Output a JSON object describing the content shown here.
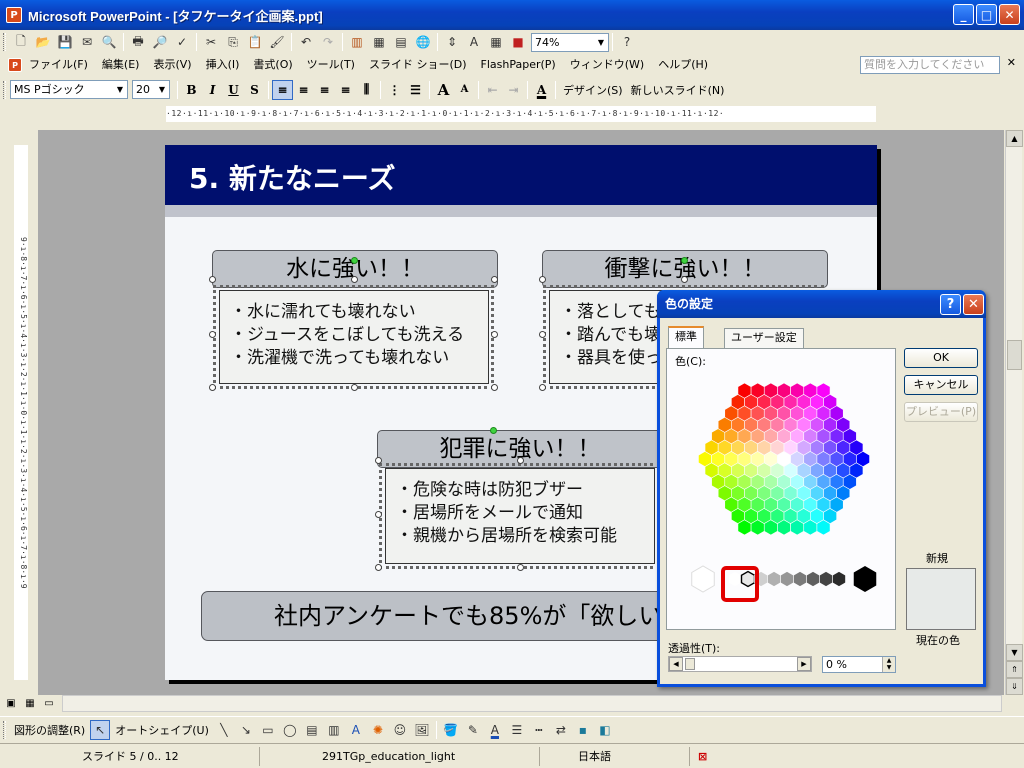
{
  "window": {
    "title": "Microsoft PowerPoint - [タフケータイ企画案.ppt]",
    "app_icon": "P",
    "min": "_",
    "max": "□",
    "close": "✕"
  },
  "toolbar": {
    "zoom": "74%",
    "help_placeholder": "質問を入力してください"
  },
  "menu": {
    "items": [
      "ファイル(F)",
      "編集(E)",
      "表示(V)",
      "挿入(I)",
      "書式(O)",
      "ツール(T)",
      "スライド ショー(D)",
      "FlashPaper(P)",
      "ウィンドウ(W)",
      "ヘルプ(H)"
    ],
    "close": "✕"
  },
  "format": {
    "font": "MS Pゴシック",
    "size": "20",
    "design": "デザイン(S)",
    "new_slide": "新しいスライド(N)"
  },
  "ruler": {
    "horizontal": "·12·ı·11·ı·10·ı·9·ı·8·ı·7·ı·6·ı·5·ı·4·ı·3·ı·2·ı·1·ı·0·ı·1·ı·2·ı·3·ı·4·ı·5·ı·6·ı·7·ı·8·ı·9·ı·10·ı·11·ı·12·",
    "vertical": "9·ı·8·ı·7·ı·6·ı·5·ı·4·ı·3·ı·2·ı·1·ı·0·ı·1·ı·2·ı·3·ı·4·ı·5·ı·6·ı·7·ı·8·ı·9"
  },
  "slide": {
    "title": "5. 新たなニーズ",
    "box1": {
      "title": "水に強い！！",
      "lines": [
        "・水に濡れても壊れない",
        "・ジュースをこぼしても洗える",
        "・洗濯機で洗っても壊れない"
      ]
    },
    "box2": {
      "title": "衝撃に強い！！",
      "lines": [
        "・落としても壊",
        "・踏んでも壊",
        "・器具を使っ"
      ]
    },
    "box3": {
      "title": "犯罪に強い！！",
      "lines": [
        "・危険な時は防犯ブザー",
        "・居場所をメールで通知",
        "・親機から居場所を検索可能"
      ]
    },
    "banner": "社内アンケートでも85%が「欲しい」"
  },
  "drawbar": {
    "adjust": "図形の調整(R)",
    "autoshape": "オートシェイプ(U)"
  },
  "status": {
    "slide": "スライド 5 / 0.. 12",
    "template": "291TGp_education_light",
    "language": "日本語"
  },
  "dialog": {
    "title": "色の設定",
    "help": "?",
    "close": "✕",
    "tab_standard": "標準",
    "tab_custom": "ユーザー設定",
    "colors_label": "色(C):",
    "ok": "OK",
    "cancel": "キャンセル",
    "preview": "プレビュー(P)",
    "new_label": "新規",
    "current_label": "現在の色",
    "transparency_label": "透過性(T):",
    "transparency_value": "0 %",
    "current_color": "#e7eae8"
  }
}
